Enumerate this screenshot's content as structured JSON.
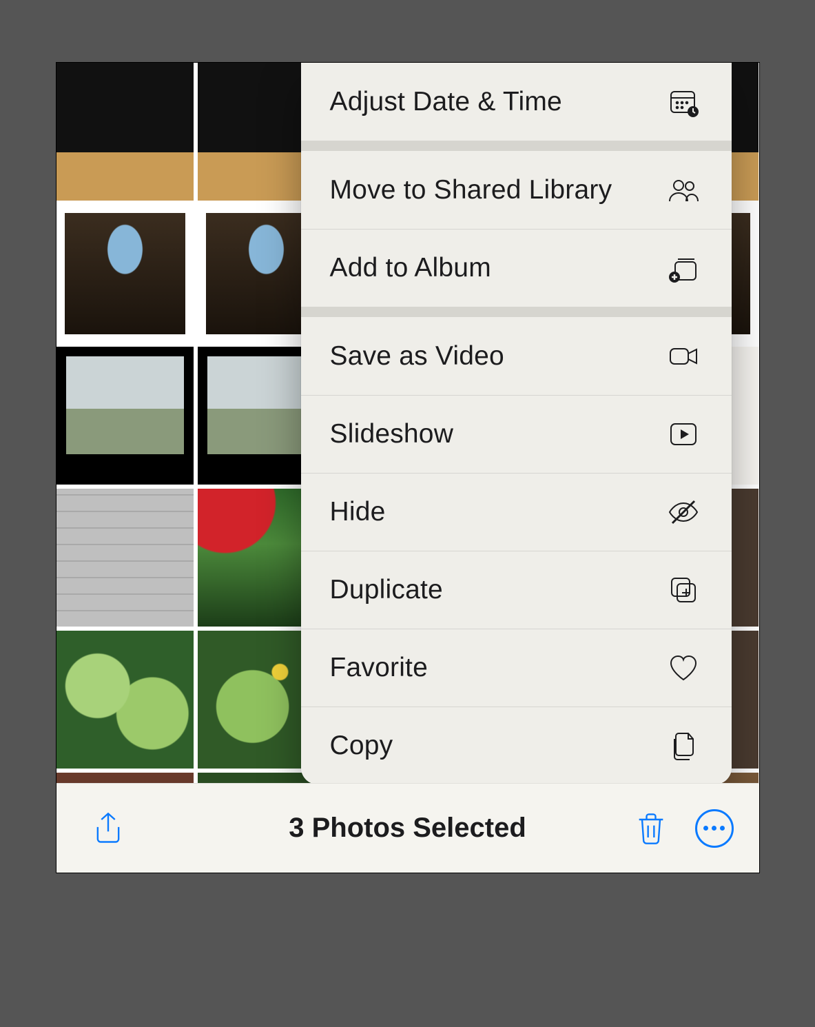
{
  "menu": {
    "groups": [
      {
        "items": [
          {
            "label": "Adjust Date & Time",
            "icon": "calendar-clock-icon"
          }
        ]
      },
      {
        "items": [
          {
            "label": "Move to Shared Library",
            "icon": "people-icon"
          },
          {
            "label": "Add to Album",
            "icon": "album-add-icon"
          }
        ]
      },
      {
        "items": [
          {
            "label": "Save as Video",
            "icon": "video-icon"
          },
          {
            "label": "Slideshow",
            "icon": "play-rect-icon"
          },
          {
            "label": "Hide",
            "icon": "eye-slash-icon"
          },
          {
            "label": "Duplicate",
            "icon": "duplicate-plus-icon"
          },
          {
            "label": "Favorite",
            "icon": "heart-icon"
          },
          {
            "label": "Copy",
            "icon": "documents-icon"
          }
        ]
      }
    ]
  },
  "toolbar": {
    "status": "3 Photos Selected",
    "share": "Share",
    "trash": "Delete",
    "more": "More"
  }
}
